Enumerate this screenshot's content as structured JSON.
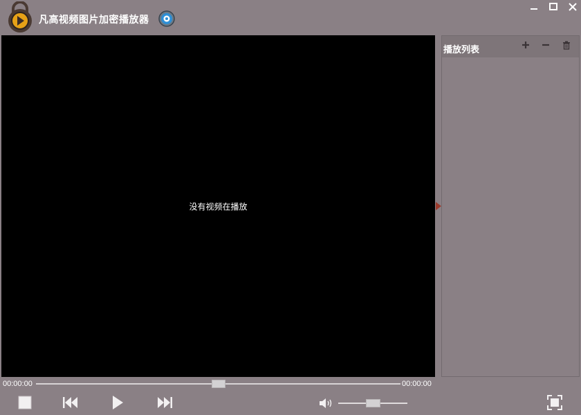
{
  "app": {
    "title": "凡高视频图片加密播放器"
  },
  "icons": {
    "logo": "lock-play-logo-icon",
    "settings": "gear-icon",
    "minimize": "minimize-icon",
    "maximize": "maximize-icon",
    "close": "close-icon",
    "add": "plus-icon",
    "remove": "minus-icon",
    "clear": "trash-icon",
    "stop": "stop-icon",
    "previous": "skip-back-icon",
    "play": "play-icon",
    "next": "skip-forward-icon",
    "volume": "speaker-icon",
    "fullscreen": "fullscreen-icon",
    "panel_toggle": "triangle-right-icon"
  },
  "video": {
    "status": "没有视频在播放"
  },
  "playlist": {
    "title": "播放列表",
    "items": []
  },
  "player": {
    "current_time": "00:00:00",
    "total_time": "00:00:00",
    "progress": 0.5,
    "volume": 0.5
  },
  "colors": {
    "background": "#8a8085",
    "video_bg": "#000000",
    "accent": "#9b3a2c",
    "logo_ring": "#4a3a33",
    "logo_fill": "#e6a117"
  }
}
